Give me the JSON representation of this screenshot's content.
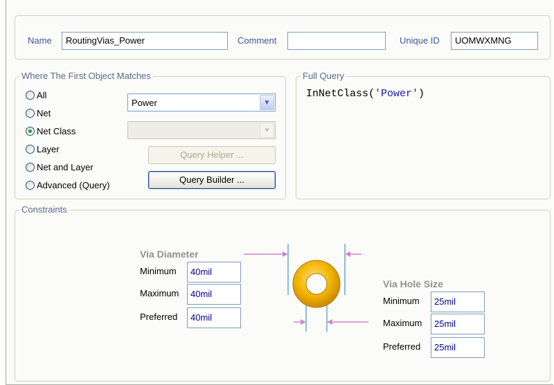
{
  "identity": {
    "name_label": "Name",
    "name_value": "RoutingVias_Power",
    "comment_label": "Comment",
    "comment_value": "",
    "uid_label": "Unique ID",
    "uid_value": "UOMWXMNG"
  },
  "where": {
    "legend": "Where The First Object Matches",
    "options": [
      "All",
      "Net",
      "Net Class",
      "Layer",
      "Net and Layer",
      "Advanced (Query)"
    ],
    "selected_option": "Net Class",
    "class_select_value": "Power",
    "second_select_value": "",
    "query_helper_label": "Query Helper ...",
    "query_builder_label": "Query Builder ..."
  },
  "full_query": {
    "legend": "Full Query",
    "func": "InNetClass(",
    "arg": "'Power'",
    "close": ")"
  },
  "constraints": {
    "legend": "Constraints",
    "via_diameter": {
      "title": "Via Diameter",
      "min_label": "Minimum",
      "min_value": "40mil",
      "max_label": "Maximum",
      "max_value": "40mil",
      "pref_label": "Preferred",
      "pref_value": "40mil"
    },
    "via_hole": {
      "title": "Via Hole Size",
      "min_label": "Minimum",
      "min_value": "25mil",
      "max_label": "Maximum",
      "max_value": "25mil",
      "pref_label": "Preferred",
      "pref_value": "25mil"
    }
  },
  "colors": {
    "label_blue": "#3c5a9c",
    "via_ring": "#f0b400",
    "dimension_arrow": "#cc88cc",
    "dimension_line": "#6aa8cc"
  }
}
